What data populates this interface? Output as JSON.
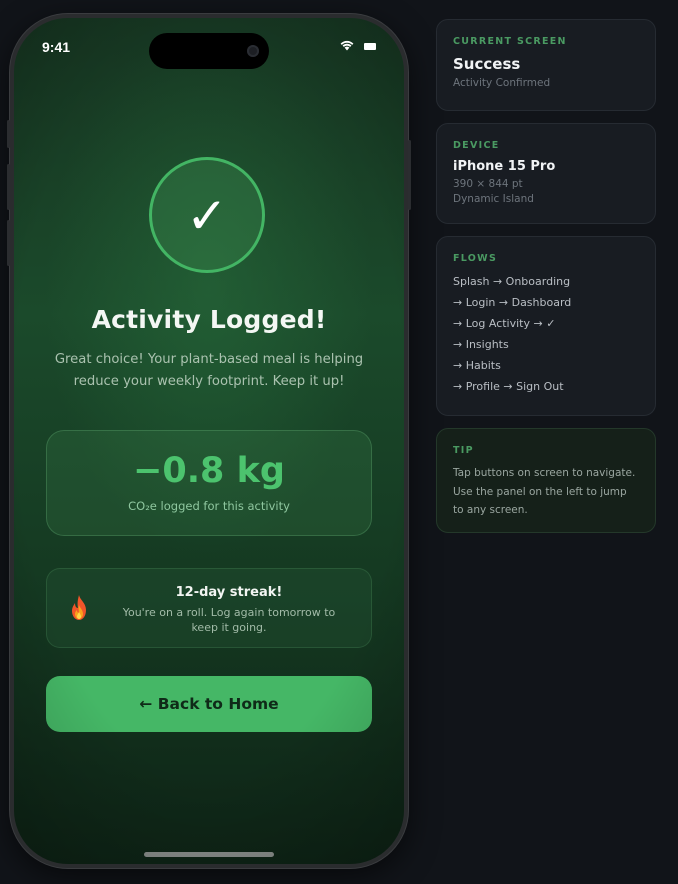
{
  "status_bar": {
    "time": "9:41"
  },
  "success": {
    "check_glyph": "✓",
    "title": "Activity Logged!",
    "subtitle": "Great choice! Your plant-based meal is helping reduce your weekly footprint. Keep it up!",
    "impact": {
      "value": "−0.8 kg",
      "label": "CO₂e logged for this activity"
    },
    "streak": {
      "icon": "fire-icon",
      "title": "12-day streak!",
      "text": "You're on a roll. Log again tomorrow to keep it going."
    },
    "home_button_label": "← Back to Home"
  },
  "side_panel": {
    "current_screen": {
      "label": "CURRENT SCREEN",
      "name": "Success",
      "detail": "Activity Confirmed"
    },
    "device": {
      "label": "DEVICE",
      "name": "iPhone 15 Pro",
      "resolution": "390 × 844 pt",
      "detail": "Dynamic Island"
    },
    "flows": {
      "label": "FLOWS",
      "items": [
        "Splash → Onboarding",
        "→ Login → Dashboard",
        "→ Log Activity → ✓",
        "→ Insights",
        "→ Habits",
        "→ Profile → Sign Out"
      ]
    },
    "tip": {
      "label": "TIP",
      "text": "Tap buttons on screen to navigate. Use the panel on the left to jump to any screen."
    }
  },
  "colors": {
    "accent_green": "#45b766",
    "impact_green": "#4cc36e",
    "background": "#111419"
  }
}
